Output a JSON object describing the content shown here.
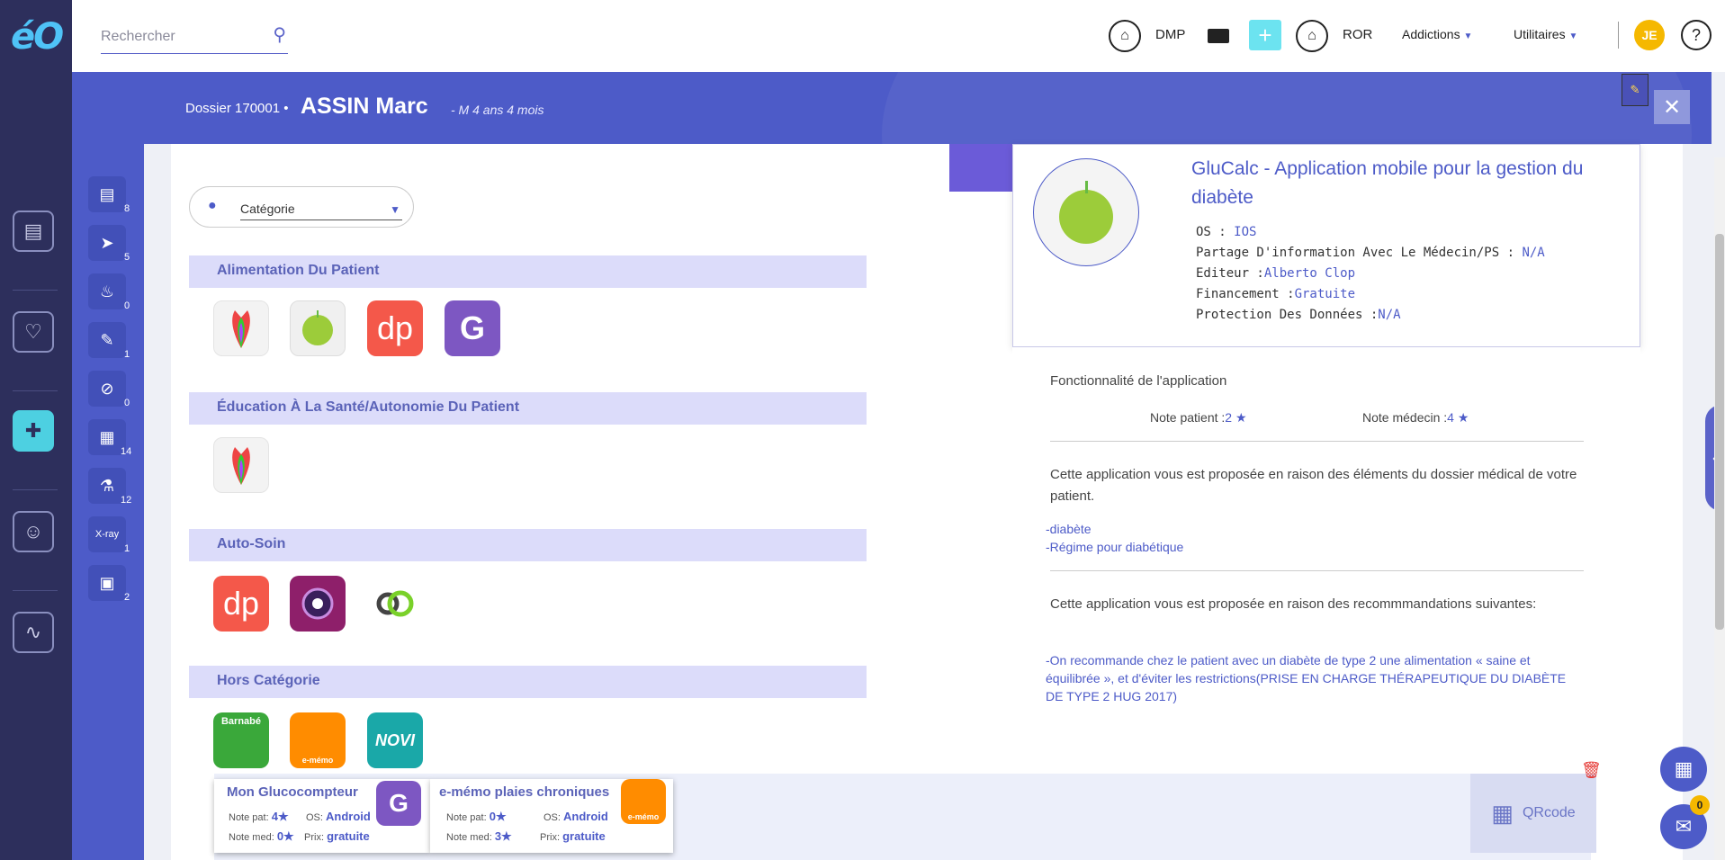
{
  "app": {
    "logo": "éO"
  },
  "topbar": {
    "search_placeholder": "Rechercher",
    "dmp_label": "DMP",
    "ror_label": "ROR",
    "menu_addictions": "Addictions",
    "menu_utilitaires": "Utilitaires",
    "avatar_initials": "JE",
    "help_label": "?",
    "plus_label": "+"
  },
  "banner": {
    "dossier_label": "Dossier 170001 •",
    "patient_name": "ASSIN Marc",
    "patient_age": "- M 4 ans 4 mois",
    "close_label": "✕"
  },
  "sidebar_tools": [
    {
      "icon": "document-icon",
      "count": "8"
    },
    {
      "icon": "paper-plane-icon",
      "count": "5"
    },
    {
      "icon": "flame-icon",
      "count": "0"
    },
    {
      "icon": "syringe-icon",
      "count": "1"
    },
    {
      "icon": "pill-icon",
      "count": "0"
    },
    {
      "icon": "images-icon",
      "count": "14"
    },
    {
      "icon": "microscope-icon",
      "count": "12"
    },
    {
      "icon": "xray-icon",
      "count": "1"
    },
    {
      "icon": "clipboard-icon",
      "count": "2"
    }
  ],
  "filter": {
    "category_label": "Catégorie"
  },
  "categories": {
    "c1": "Alimentation Du Patient",
    "c2": "Éducation À La Santé/Autonomie Du Patient",
    "c3": "Auto-Soin",
    "c4": "Hors Catégorie"
  },
  "icon_texts": {
    "dp": "dp",
    "g": "G",
    "barnabe": "Barnabé",
    "ememo": "e-mémo",
    "novi": "NOVI"
  },
  "detail": {
    "title": "GluCalc - Application mobile pour la gestion du diabète",
    "os_label": "OS : ",
    "os_value": "IOS",
    "share_label": "Partage D'information Avec Le Médecin/PS : ",
    "share_value": "N/A",
    "editor_label": "Editeur :",
    "editor_value": "Alberto Clop",
    "funding_label": "Financement :",
    "funding_value": "Gratuite",
    "privacy_label": "Protection Des Données :",
    "privacy_value": "N/A",
    "functionality_label": "Fonctionnalité de l'application",
    "patient_rating_label": "Note patient :",
    "patient_rating_value": "2",
    "doctor_rating_label": "Note médecin :",
    "doctor_rating_value": "4",
    "reason_records": "Cette application vous est proposée en raison des éléments du dossier médical de votre patient.",
    "record_item_1": "-diabète",
    "record_item_2": "-Régime pour diabétique",
    "reason_reco": "Cette application vous est proposée en raison des recommmandations suivantes:",
    "reco_item": "-On recommande chez le patient avec un diabète de type 2 une alimentation « saine et équilibrée », et d'éviter les restrictions(PRISE EN CHARGE THÉRAPEUTIQUE DU DIABÈTE DE TYPE 2 HUG 2017)"
  },
  "tray": {
    "cards": [
      {
        "title": "Mon Glucocompteur",
        "note_pat_label": "Note pat:",
        "note_pat": "4",
        "note_med_label": "Note med:",
        "note_med": "0",
        "os_label": "OS:",
        "os": "Android",
        "price_label": "Prix:",
        "price": "gratuite"
      },
      {
        "title": "e-mémo plaies chroniques",
        "note_pat_label": "Note pat:",
        "note_pat": "0",
        "note_med_label": "Note med:",
        "note_med": "3",
        "os_label": "OS:",
        "os": "Android",
        "price_label": "Prix:",
        "price": "gratuite"
      }
    ],
    "qrcode_label": "QRcode"
  },
  "floating": {
    "mail_badge": "0"
  },
  "colors": {
    "primary": "#4d5bc8",
    "nav": "#2d2f5c",
    "accent": "#4dd0e1",
    "header_band": "#dcdcfa"
  }
}
